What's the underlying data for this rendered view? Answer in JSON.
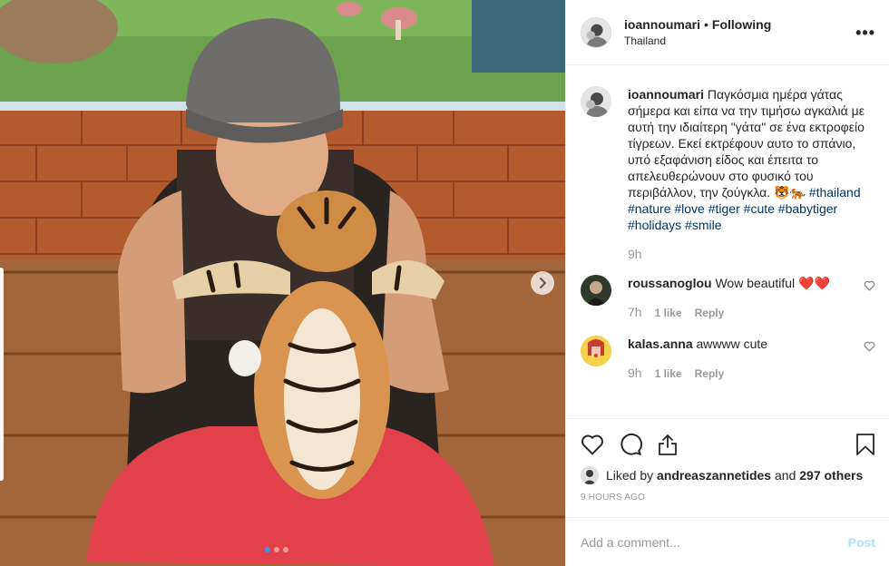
{
  "post": {
    "username": "ioannoumari",
    "separator": "•",
    "follow_status": "Following",
    "location": "Thailand",
    "more_label": "•••"
  },
  "caption": {
    "username": "ioannoumari",
    "text": "Παγκόσμια ημέρα γάτας σήμερα και είπα να την τιμήσω αγκαλιά με αυτή την ιδιαίτερη \"γάτα\" σε ένα εκτροφείο τίγρεων. Εκεί εκτρέφουν αυτο το σπάνιο, υπό εξαφάνιση είδος και έπειτα το απελευθερώνουν στο φυσικό του περιβάλλον, την ζούγκλα. 🐯🐅",
    "hashtags": [
      "#thailand",
      "#nature",
      "#love",
      "#tiger",
      "#cute",
      "#babytiger",
      "#holidays",
      "#smile"
    ],
    "time": "9h"
  },
  "comments": [
    {
      "username": "roussanoglou",
      "text": "Wow beautiful ❤️❤️",
      "time": "7h",
      "likes": "1 like",
      "reply": "Reply"
    },
    {
      "username": "kalas.anna",
      "text": "awwww cute",
      "time": "9h",
      "likes": "1 like",
      "reply": "Reply"
    }
  ],
  "likes": {
    "prefix": "Liked by",
    "user": "andreaszannetides",
    "connector": "and",
    "count": "297 others"
  },
  "timestamp": "9 HOURS AGO",
  "add_comment": {
    "placeholder": "Add a comment...",
    "post_label": "Post"
  },
  "carousel": {
    "current": 1,
    "total": 3
  },
  "icons": {
    "like": "heart-icon",
    "comment": "comment-icon",
    "share": "share-icon",
    "save": "bookmark-icon",
    "next": "chevron-right-icon"
  },
  "colors": {
    "link": "#003569",
    "accent": "#3897f0",
    "muted": "#999999",
    "post_disabled": "#b2dffc",
    "heart_red": "#ed4956"
  }
}
